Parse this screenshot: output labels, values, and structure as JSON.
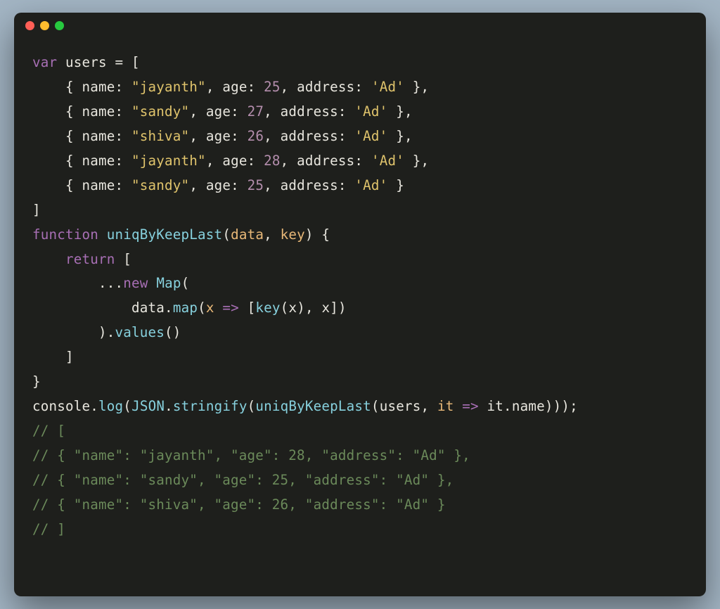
{
  "window": {
    "buttons": [
      "close",
      "minimize",
      "zoom"
    ]
  },
  "code": {
    "lines": [
      [
        {
          "t": "kw",
          "v": "var"
        },
        {
          "t": "punc",
          "v": " "
        },
        {
          "t": "ident",
          "v": "users"
        },
        {
          "t": "punc",
          "v": " = ["
        }
      ],
      [
        {
          "t": "punc",
          "v": "    { "
        },
        {
          "t": "objkey",
          "v": "name"
        },
        {
          "t": "punc",
          "v": ": "
        },
        {
          "t": "str",
          "v": "\"jayanth\""
        },
        {
          "t": "punc",
          "v": ", "
        },
        {
          "t": "objkey",
          "v": "age"
        },
        {
          "t": "punc",
          "v": ": "
        },
        {
          "t": "num",
          "v": "25"
        },
        {
          "t": "punc",
          "v": ", "
        },
        {
          "t": "objkey",
          "v": "address"
        },
        {
          "t": "punc",
          "v": ": "
        },
        {
          "t": "str",
          "v": "'Ad'"
        },
        {
          "t": "punc",
          "v": " },"
        }
      ],
      [
        {
          "t": "punc",
          "v": "    { "
        },
        {
          "t": "objkey",
          "v": "name"
        },
        {
          "t": "punc",
          "v": ": "
        },
        {
          "t": "str",
          "v": "\"sandy\""
        },
        {
          "t": "punc",
          "v": ", "
        },
        {
          "t": "objkey",
          "v": "age"
        },
        {
          "t": "punc",
          "v": ": "
        },
        {
          "t": "num",
          "v": "27"
        },
        {
          "t": "punc",
          "v": ", "
        },
        {
          "t": "objkey",
          "v": "address"
        },
        {
          "t": "punc",
          "v": ": "
        },
        {
          "t": "str",
          "v": "'Ad'"
        },
        {
          "t": "punc",
          "v": " },"
        }
      ],
      [
        {
          "t": "punc",
          "v": "    { "
        },
        {
          "t": "objkey",
          "v": "name"
        },
        {
          "t": "punc",
          "v": ": "
        },
        {
          "t": "str",
          "v": "\"shiva\""
        },
        {
          "t": "punc",
          "v": ", "
        },
        {
          "t": "objkey",
          "v": "age"
        },
        {
          "t": "punc",
          "v": ": "
        },
        {
          "t": "num",
          "v": "26"
        },
        {
          "t": "punc",
          "v": ", "
        },
        {
          "t": "objkey",
          "v": "address"
        },
        {
          "t": "punc",
          "v": ": "
        },
        {
          "t": "str",
          "v": "'Ad'"
        },
        {
          "t": "punc",
          "v": " },"
        }
      ],
      [
        {
          "t": "punc",
          "v": "    { "
        },
        {
          "t": "objkey",
          "v": "name"
        },
        {
          "t": "punc",
          "v": ": "
        },
        {
          "t": "str",
          "v": "\"jayanth\""
        },
        {
          "t": "punc",
          "v": ", "
        },
        {
          "t": "objkey",
          "v": "age"
        },
        {
          "t": "punc",
          "v": ": "
        },
        {
          "t": "num",
          "v": "28"
        },
        {
          "t": "punc",
          "v": ", "
        },
        {
          "t": "objkey",
          "v": "address"
        },
        {
          "t": "punc",
          "v": ": "
        },
        {
          "t": "str",
          "v": "'Ad'"
        },
        {
          "t": "punc",
          "v": " },"
        }
      ],
      [
        {
          "t": "punc",
          "v": "    { "
        },
        {
          "t": "objkey",
          "v": "name"
        },
        {
          "t": "punc",
          "v": ": "
        },
        {
          "t": "str",
          "v": "\"sandy\""
        },
        {
          "t": "punc",
          "v": ", "
        },
        {
          "t": "objkey",
          "v": "age"
        },
        {
          "t": "punc",
          "v": ": "
        },
        {
          "t": "num",
          "v": "25"
        },
        {
          "t": "punc",
          "v": ", "
        },
        {
          "t": "objkey",
          "v": "address"
        },
        {
          "t": "punc",
          "v": ": "
        },
        {
          "t": "str",
          "v": "'Ad'"
        },
        {
          "t": "punc",
          "v": " }"
        }
      ],
      [
        {
          "t": "punc",
          "v": "]"
        }
      ],
      [
        {
          "t": "kw",
          "v": "function"
        },
        {
          "t": "punc",
          "v": " "
        },
        {
          "t": "fn",
          "v": "uniqByKeepLast"
        },
        {
          "t": "punc",
          "v": "("
        },
        {
          "t": "param",
          "v": "data"
        },
        {
          "t": "punc",
          "v": ", "
        },
        {
          "t": "param",
          "v": "key"
        },
        {
          "t": "punc",
          "v": ") {"
        }
      ],
      [
        {
          "t": "punc",
          "v": "    "
        },
        {
          "t": "kw",
          "v": "return"
        },
        {
          "t": "punc",
          "v": " ["
        }
      ],
      [
        {
          "t": "punc",
          "v": "        ..."
        },
        {
          "t": "kw",
          "v": "new"
        },
        {
          "t": "punc",
          "v": " "
        },
        {
          "t": "class",
          "v": "Map"
        },
        {
          "t": "punc",
          "v": "("
        }
      ],
      [
        {
          "t": "punc",
          "v": "            "
        },
        {
          "t": "ident",
          "v": "data"
        },
        {
          "t": "punc",
          "v": "."
        },
        {
          "t": "fn",
          "v": "map"
        },
        {
          "t": "punc",
          "v": "("
        },
        {
          "t": "param",
          "v": "x"
        },
        {
          "t": "punc",
          "v": " "
        },
        {
          "t": "kw",
          "v": "=>"
        },
        {
          "t": "punc",
          "v": " ["
        },
        {
          "t": "fn",
          "v": "key"
        },
        {
          "t": "punc",
          "v": "("
        },
        {
          "t": "ident",
          "v": "x"
        },
        {
          "t": "punc",
          "v": "), "
        },
        {
          "t": "ident",
          "v": "x"
        },
        {
          "t": "punc",
          "v": "])"
        }
      ],
      [
        {
          "t": "punc",
          "v": "        )."
        },
        {
          "t": "fn",
          "v": "values"
        },
        {
          "t": "punc",
          "v": "()"
        }
      ],
      [
        {
          "t": "punc",
          "v": "    ]"
        }
      ],
      [
        {
          "t": "punc",
          "v": "}"
        }
      ],
      [
        {
          "t": "ident",
          "v": "console"
        },
        {
          "t": "punc",
          "v": "."
        },
        {
          "t": "fn",
          "v": "log"
        },
        {
          "t": "punc",
          "v": "("
        },
        {
          "t": "class",
          "v": "JSON"
        },
        {
          "t": "punc",
          "v": "."
        },
        {
          "t": "fn",
          "v": "stringify"
        },
        {
          "t": "punc",
          "v": "("
        },
        {
          "t": "fn",
          "v": "uniqByKeepLast"
        },
        {
          "t": "punc",
          "v": "("
        },
        {
          "t": "ident",
          "v": "users"
        },
        {
          "t": "punc",
          "v": ", "
        },
        {
          "t": "param",
          "v": "it"
        },
        {
          "t": "punc",
          "v": " "
        },
        {
          "t": "kw",
          "v": "=>"
        },
        {
          "t": "punc",
          "v": " "
        },
        {
          "t": "ident",
          "v": "it"
        },
        {
          "t": "punc",
          "v": "."
        },
        {
          "t": "ident",
          "v": "name"
        },
        {
          "t": "punc",
          "v": ")));"
        }
      ],
      [
        {
          "t": "cmt",
          "v": "// ["
        }
      ],
      [
        {
          "t": "cmt",
          "v": "// { \"name\": \"jayanth\", \"age\": 28, \"address\": \"Ad\" },"
        }
      ],
      [
        {
          "t": "cmt",
          "v": "// { \"name\": \"sandy\", \"age\": 25, \"address\": \"Ad\" },"
        }
      ],
      [
        {
          "t": "cmt",
          "v": "// { \"name\": \"shiva\", \"age\": 26, \"address\": \"Ad\" }"
        }
      ],
      [
        {
          "t": "cmt",
          "v": "// ]"
        }
      ]
    ]
  }
}
